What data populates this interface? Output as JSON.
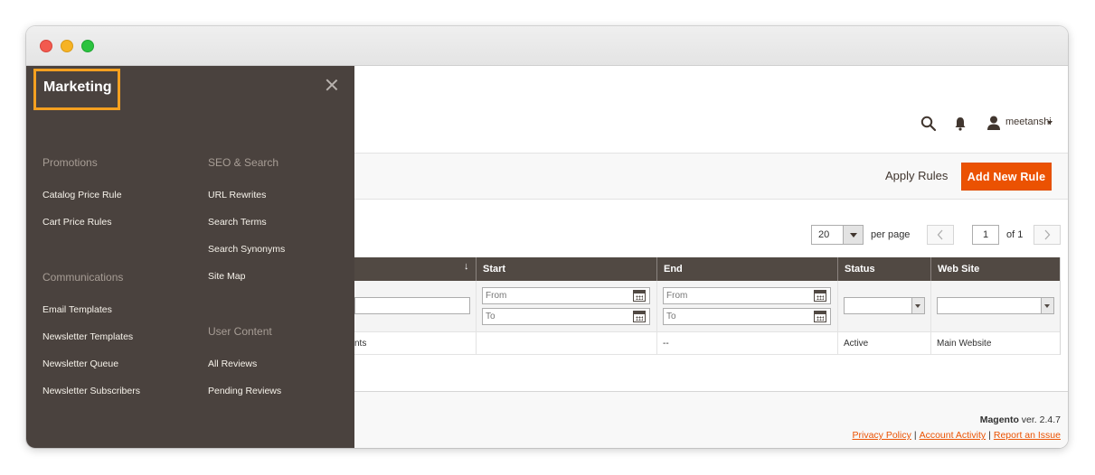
{
  "window": {
    "controls": [
      "close",
      "minimize",
      "zoom"
    ]
  },
  "header": {
    "user_name": "meetanshi"
  },
  "actions": {
    "apply_rules": "Apply Rules",
    "add_new_rule": "Add New Rule"
  },
  "pager": {
    "per_page_value": "20",
    "per_page_label": "per page",
    "page": "1",
    "of_pages": "of 1"
  },
  "grid": {
    "columns": [
      "Start",
      "End",
      "Status",
      "Web Site"
    ],
    "filters": {
      "from_placeholder": "From",
      "to_placeholder": "To"
    },
    "row": {
      "name_fragment": "nts",
      "start": "",
      "end": "--",
      "status": "Active",
      "website": "Main Website"
    }
  },
  "footer": {
    "brand": "Magento",
    "version": "ver. 2.4.7",
    "links": [
      "Privacy Policy",
      "Account Activity",
      "Report an Issue"
    ],
    "separator": "|"
  },
  "flyout": {
    "title": "Marketing",
    "sections": [
      {
        "title": "Promotions",
        "items": [
          "Catalog Price Rule",
          "Cart Price Rules"
        ]
      },
      {
        "title": "SEO & Search",
        "items": [
          "URL Rewrites",
          "Search Terms",
          "Search Synonyms",
          "Site Map"
        ]
      },
      {
        "title": "Communications",
        "items": [
          "Email Templates",
          "Newsletter Templates",
          "Newsletter Queue",
          "Newsletter Subscribers"
        ]
      },
      {
        "title": "User Content",
        "items": [
          "All Reviews",
          "Pending Reviews"
        ]
      }
    ]
  },
  "colors": {
    "accent": "#eb5202",
    "flyout_bg": "#4a423e",
    "highlight_box": "#f4a020",
    "grid_header": "#514943"
  }
}
